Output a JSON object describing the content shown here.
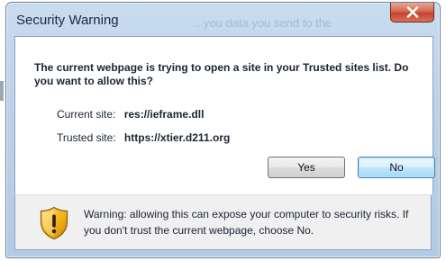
{
  "dialog": {
    "title": "Security Warning",
    "background_text": "...you data you send to the",
    "close_label": "Close"
  },
  "message": {
    "heading": "The current webpage is trying to open a site in your Trusted sites list. Do you want to allow this?",
    "current_site_label": "Current site:",
    "current_site_value": "res://ieframe.dll",
    "trusted_site_label": "Trusted site:",
    "trusted_site_value": "https://xtier.d211.org"
  },
  "buttons": {
    "yes_label": "Yes",
    "no_label": "No"
  },
  "footer": {
    "warning_text": "Warning: allowing this can expose your computer to security risks. If you don't trust the current webpage, choose No.",
    "icon": "shield-warning-icon"
  },
  "colors": {
    "title_bar": "#bcd2ea",
    "close_button": "#c2452c",
    "default_button": "#bee6fd",
    "footer_background": "#f0f0f0",
    "shield_yellow": "#f3b21a"
  }
}
